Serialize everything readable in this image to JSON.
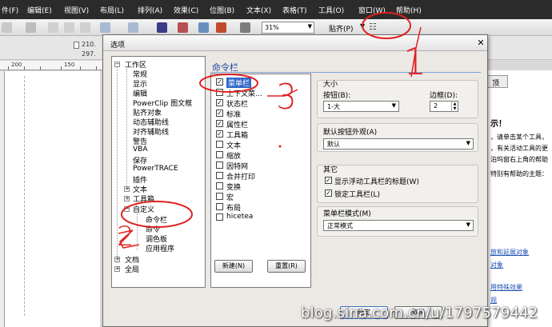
{
  "menu": [
    "件(F)",
    "编辑(E)",
    "视图(V)",
    "布局(L)",
    "排列(A)",
    "效果(C)",
    "位图(B)",
    "文本(X)",
    "表格(T)",
    "工具(O)",
    "窗口(W)",
    "帮助(H)"
  ],
  "toolbar": {
    "zoom": "31%",
    "snap_label": "贴齐(P)"
  },
  "propbar": {
    "width": "210.",
    "height": "297."
  },
  "ruler": {
    "labels": [
      "200",
      "150"
    ]
  },
  "dialog": {
    "title": "选项",
    "tree": {
      "root": "工作区",
      "children": [
        "常规",
        "显示",
        "编辑",
        "PowerClip 图文框",
        "贴齐对象",
        "动态辅助线",
        "对齐辅助线",
        "警告",
        "VBA",
        "保存",
        "PowerTRACE",
        "插件"
      ],
      "text": "文本",
      "toolbox": "工具箱",
      "customize": "自定义",
      "customize_children": [
        "命令栏",
        "命令",
        "调色板",
        "应用程序"
      ],
      "document": "文档",
      "global": "全局"
    },
    "section_title": "命令栏",
    "commands": [
      {
        "label": "菜单栏",
        "checked": true,
        "selected": true
      },
      {
        "label": "上下文菜...",
        "checked": false
      },
      {
        "label": "状态栏",
        "checked": true
      },
      {
        "label": "标准",
        "checked": true
      },
      {
        "label": "属性栏",
        "checked": true
      },
      {
        "label": "工具箱",
        "checked": true
      },
      {
        "label": "文本",
        "checked": false
      },
      {
        "label": "缩放",
        "checked": false
      },
      {
        "label": "因特网",
        "checked": false
      },
      {
        "label": "合并打印",
        "checked": false
      },
      {
        "label": "变换",
        "checked": false
      },
      {
        "label": "宏",
        "checked": false
      },
      {
        "label": "布局",
        "checked": false
      },
      {
        "label": "hicetea",
        "checked": false
      }
    ],
    "new_button": "新建(N)",
    "reset_button": "重置(R)",
    "size_group": {
      "label": "大小",
      "button_label": "按钮(B):",
      "button_value": "1-大",
      "border_label": "边框(D):",
      "border_value": "2"
    },
    "appearance": {
      "label": "默认按钮外观(A)",
      "value": "默认"
    },
    "other": {
      "label": "其它",
      "floating_title": "显示浮动工具栏的标题(W)",
      "lock_toolbar": "锁定工具栏(L)"
    },
    "menubar_mode": {
      "label": "菜单栏模式(M)",
      "value": "正常模式"
    },
    "ok_button": "确定",
    "cancel_button": "取消"
  },
  "docker": {
    "tab": "顶",
    "lines": [
      "示！",
      "，请单击某个工具，",
      "，有关活动工具的更",
      "泊坞窗右上角的帮助",
      "特别有帮助的主题："
    ],
    "links": [
      "放和延展对象",
      "对象",
      "",
      "用特殊效果",
      "观"
    ]
  },
  "watermark": "blog.sina.com.cn/u/1797579442",
  "annotations": {
    "three": "3",
    "two": "2",
    "one": "1"
  },
  "colors": {
    "menubar": "#2b2b2b",
    "selection": "#3167c8",
    "annotation": "#e02020",
    "title_text": "#1f4aa0"
  }
}
